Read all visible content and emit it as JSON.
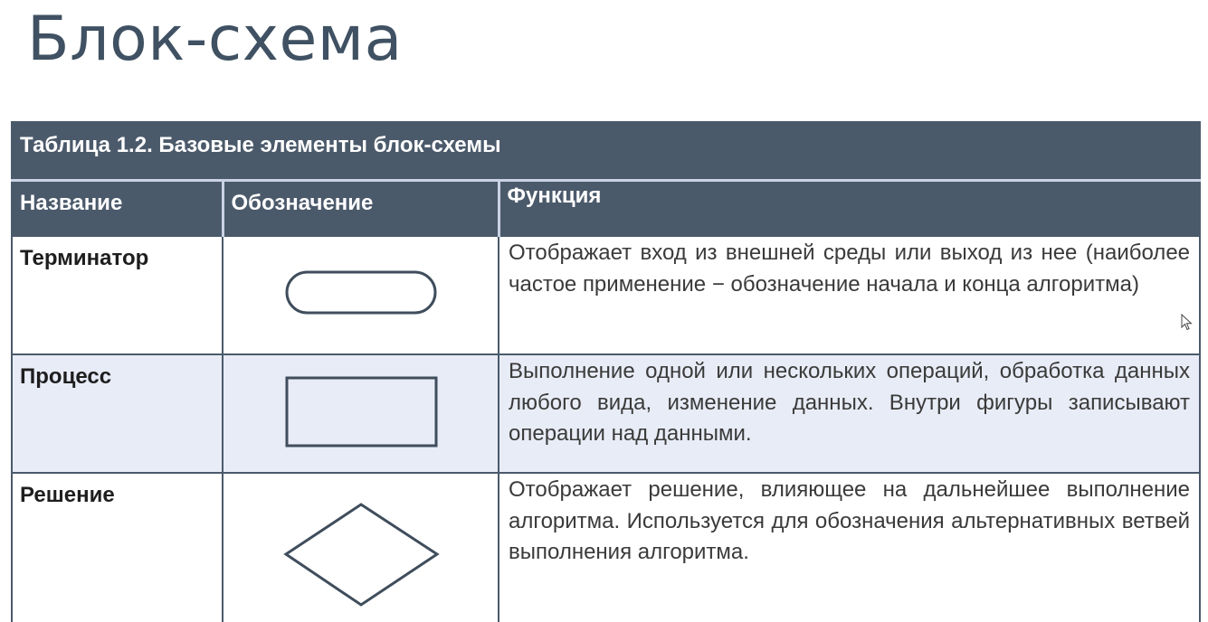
{
  "slide": {
    "title": "Блок-схема"
  },
  "table": {
    "caption": "Таблица 1.2. Базовые элементы блок-схемы",
    "headers": [
      "Название",
      "Обозначение",
      "Функция"
    ],
    "rows": [
      {
        "name": "Терминатор",
        "symbol": "terminator-oval-icon",
        "function": "Отображает вход из внешней среды или выход из нее (наиболее частое применение − обозначение начала и конца алгоритма)"
      },
      {
        "name": "Процесс",
        "symbol": "process-rectangle-icon",
        "function": "Выполнение одной или нескольких операций, обработка данных любого вида, изменение данных. Внутри фигуры записывают операции над данными."
      },
      {
        "name": "Решение",
        "symbol": "decision-diamond-icon",
        "function": "Отображает решение, влияющее на дальнейшее выполнение алгоритма. Используется для обозначения альтернативных ветвей выполнения алгоритма."
      }
    ]
  },
  "colors": {
    "header_bg": "#4b5a6b",
    "title_text": "#3f5162",
    "alt_row_bg": "#e8ecf6",
    "shape_stroke": "#3f4d5c"
  },
  "cursor": {
    "icon": "mouse-pointer-icon"
  }
}
